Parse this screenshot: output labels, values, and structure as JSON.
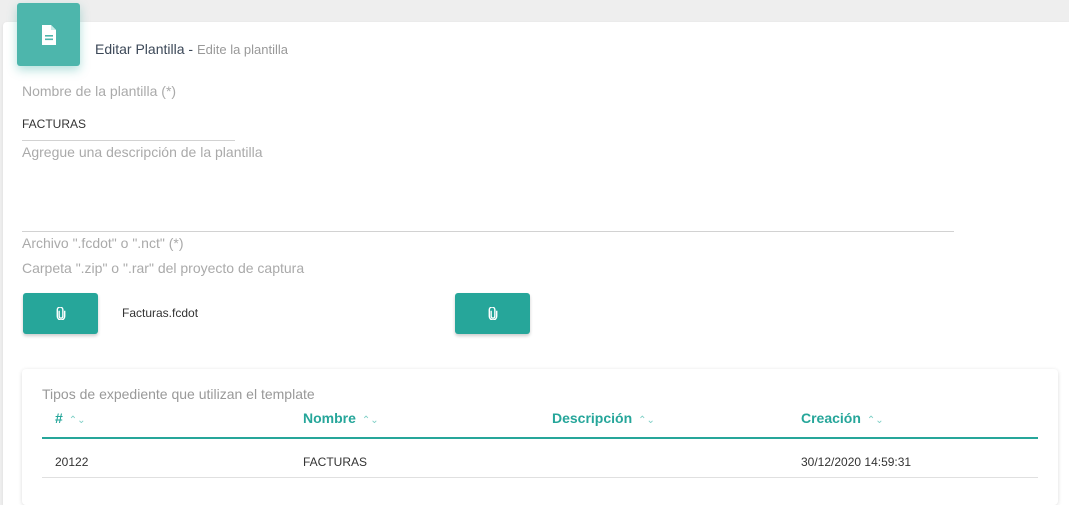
{
  "header": {
    "title": "Editar Plantilla",
    "separator": " - ",
    "subtitle": "Edite la plantilla",
    "icon": "document-icon"
  },
  "form": {
    "name_label": "Nombre de la plantilla (*)",
    "name_value": "FACTURAS",
    "description_placeholder": "Agregue una descripción de la plantilla",
    "description_value": "",
    "file_label": "Archivo \".fcdot\" o \".nct\" (*)",
    "folder_label": "Carpeta \".zip\" o \".rar\" del proyecto de captura",
    "file_button_icon": "paperclip-icon",
    "file_name": "Facturas.fcdot",
    "folder_button_icon": "paperclip-icon"
  },
  "table": {
    "title": "Tipos de expediente que utilizan el template",
    "columns": [
      "#",
      "Nombre",
      "Descripción",
      "Creación"
    ],
    "sort_icon": "⌃⌄",
    "rows": [
      {
        "id": "20122",
        "nombre": "FACTURAS",
        "descripcion": "",
        "creacion": "30/12/2020 14:59:31"
      }
    ]
  },
  "colors": {
    "accent": "#26a69a",
    "icon_bg": "#4db6ac",
    "card_bg": "#ffffff",
    "page_bg": "#eeeeee"
  }
}
